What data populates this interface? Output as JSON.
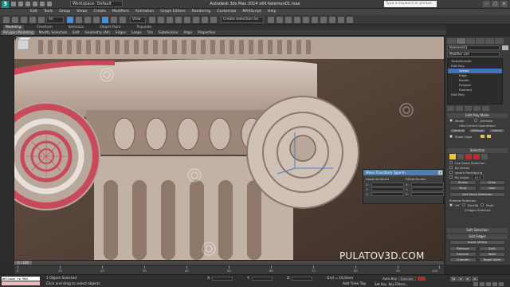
{
  "app": {
    "logo": "3",
    "workspace": "Workspace: Default",
    "title": "Autodesk 3ds Max 2014 x64      Kelemen01.max",
    "search_placeholder": "Type a keyword or phrase",
    "window_buttons": [
      "–",
      "□",
      "×"
    ]
  },
  "menu": [
    "Edit",
    "Tools",
    "Group",
    "Views",
    "Create",
    "Modifiers",
    "Animation",
    "Graph Editors",
    "Rendering",
    "Customize",
    "MAXScript",
    "Help"
  ],
  "toolbar": {
    "selection_filter": "All",
    "ref_coord": "View",
    "named_selection": "Create Selection Se"
  },
  "ribbon": {
    "tabs": [
      "Modeling",
      "Freeform",
      "Selection",
      "Object Paint",
      "Populate"
    ],
    "active_tab": "Modeling",
    "sub_items": [
      "Polygon Modeling",
      "Modify Selection",
      "Edit",
      "Geometry (All)",
      "Edges",
      "Loops",
      "Tris",
      "Subdivision",
      "Align",
      "Properties"
    ]
  },
  "viewport": {
    "watermark": "PULATOV3D.COM",
    "bg_color": "#5c4a3e",
    "stone_color": "#c7b8ad",
    "selection_color": "#c84a5a"
  },
  "dialog": {
    "title": "Move Transform Type-In",
    "close": "x",
    "absolute_header": "Absolute:World",
    "offset_header": "Offset:Screen",
    "axes": [
      "X:",
      "Y:",
      "Z:"
    ]
  },
  "command_panel": {
    "object_name": "Kelemen01",
    "modifier_list": "Modifier List",
    "stack": [
      {
        "label": "TurboSmooth",
        "level": 0,
        "selected": false
      },
      {
        "label": "Edit Poly",
        "level": 0,
        "selected": false
      },
      {
        "label": "Vertex",
        "level": 1,
        "selected": true
      },
      {
        "label": "Edge",
        "level": 1,
        "selected": false
      },
      {
        "label": "Border",
        "level": 1,
        "selected": false
      },
      {
        "label": "Polygon",
        "level": 1,
        "selected": false
      },
      {
        "label": "Element",
        "level": 1,
        "selected": false
      },
      {
        "label": "Edit Poly",
        "level": 0,
        "selected": false
      }
    ],
    "edit_poly_mode": {
      "header": "Edit Poly Mode",
      "model": "Model",
      "animate": "Animate",
      "current_op": "<No Current Operation>",
      "commit": "Commit",
      "settings": "Settings",
      "cancel": "Cancel",
      "show_cage": "Show Cage"
    },
    "selection": {
      "header": "Selection",
      "use_stack": "Use Stack Selection",
      "by_vertex": "By Vertex",
      "ignore_backfacing": "Ignore Backfacing",
      "by_angle": "By Angle:",
      "by_angle_value": "45.0",
      "shrink": "Shrink",
      "grow": "Grow",
      "ring": "Ring",
      "loop": "Loop",
      "get_stack": "Get Stack Selection",
      "preview": "Preview Selection",
      "off": "Off",
      "subobj": "SubObj",
      "multi": "Multi",
      "status": "0 Edges Selected"
    },
    "soft_selection": "Soft Selection",
    "edit_edges": {
      "header": "Edit Edges",
      "insert_vertex": "Insert Vertex",
      "remove": "Remove",
      "split": "Split",
      "extrude": "Extrude",
      "weld": "Weld",
      "chamfer": "Chamfer",
      "target_weld": "Target Weld"
    }
  },
  "timeline": {
    "thumb": "0 / 100",
    "ticks": [
      "0",
      "10",
      "20",
      "30",
      "40",
      "50",
      "60",
      "70",
      "80",
      "90",
      "100"
    ]
  },
  "status": {
    "maxscript": "Welcome to MAX",
    "line1": "1 Object Selected",
    "line2": "Click and drag to select objects",
    "x_label": "X:",
    "y_label": "Y:",
    "z_label": "Z:",
    "grid": "Grid = 10,0mm",
    "add_time_tag": "Add Time Tag",
    "auto_key": "Auto Key",
    "selected": "Selected",
    "set_key": "Set Key",
    "key_filters": "Key Filters...",
    "frame": "0"
  }
}
